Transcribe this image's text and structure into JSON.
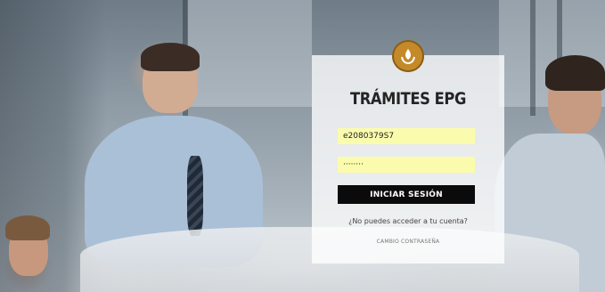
{
  "login": {
    "title": "TRÁMITES EPG",
    "username_value": "e2080379S7",
    "password_value": "········",
    "submit_label": "INICIAR SESIÓN",
    "access_link": "¿No puedes acceder a tu cuenta?",
    "change_password_link": "CAMBIO CONTRASEÑA"
  },
  "colors": {
    "logo": "#c48a2a",
    "input_bg": "#fbfbad",
    "button_bg": "#0b0b0b"
  }
}
